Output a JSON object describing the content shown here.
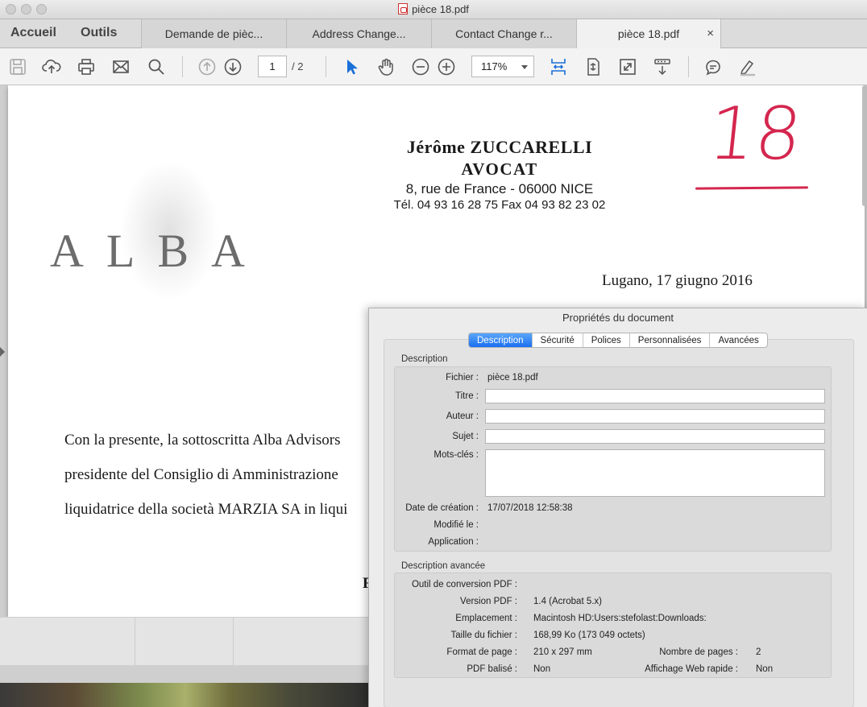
{
  "window": {
    "title": "pièce 18.pdf"
  },
  "nav": {
    "home": "Accueil",
    "tools": "Outils"
  },
  "tabs": [
    {
      "label": "Demande de pièc..."
    },
    {
      "label": "Address Change..."
    },
    {
      "label": "Contact Change r..."
    },
    {
      "label": "pièce 18.pdf",
      "close": "×"
    }
  ],
  "toolbar": {
    "page_current": "1",
    "page_total": "/ 2",
    "zoom": "117%",
    "icons": [
      "save-icon",
      "upload-icon",
      "print-icon",
      "mail-icon",
      "search-icon",
      "prev-page-icon",
      "next-page-icon",
      "select-arrow-icon",
      "hand-icon",
      "zoom-out-icon",
      "zoom-in-icon",
      "scroll-mode-icon",
      "fit-page-icon",
      "full-screen-icon",
      "read-mode-icon",
      "comment-icon",
      "highlight-icon"
    ],
    "accent_color": "#1a6fd8"
  },
  "document": {
    "logo": "ALBA",
    "letterhead": {
      "name": "Jérôme ZUCCARELLI",
      "title": "AVOCAT",
      "address": "8, rue de France - 06000 NICE",
      "phone": "Tél. 04 93 16 28 75  Fax 04 93 82 23 02"
    },
    "piece_number": "18",
    "place_date": "Lugano, 17 giugno 2016",
    "body_lines": [
      "Con la presente, la sottoscritta Alba Advisors",
      "presidente del Consiglio di Amministrazione",
      "liquidatrice della società MARZIA SA in liqui"
    ],
    "body_fragment": "F",
    "stamp_color": "#d4264e"
  },
  "dialog": {
    "title": "Propriétés du document",
    "tabs": [
      "Description",
      "Sécurité",
      "Polices",
      "Personnalisées",
      "Avancées"
    ],
    "active_tab": "Description",
    "description": {
      "group_label": "Description",
      "fields": {
        "file_label": "Fichier :",
        "file_value": "pièce 18.pdf",
        "title_label": "Titre :",
        "title_value": "",
        "author_label": "Auteur :",
        "author_value": "",
        "subject_label": "Sujet :",
        "subject_value": "",
        "keywords_label": "Mots-clés :",
        "keywords_value": "",
        "created_label": "Date de création :",
        "created_value": "17/07/2018 12:58:38",
        "modified_label": "Modifié le :",
        "modified_value": "",
        "application_label": "Application :",
        "application_value": ""
      }
    },
    "advanced": {
      "group_label": "Description avancée",
      "fields": {
        "converter_label": "Outil de conversion PDF :",
        "converter_value": "",
        "version_label": "Version PDF :",
        "version_value": "1.4 (Acrobat 5.x)",
        "location_label": "Emplacement :",
        "location_value": "Macintosh HD:Users:stefolast:Downloads:",
        "size_label": "Taille du fichier :",
        "size_value": "168,99 Ko (173 049 octets)",
        "page_format_label": "Format de page :",
        "page_format_value": "210 x 297 mm",
        "page_count_label": "Nombre de pages :",
        "page_count_value": "2",
        "tagged_label": "PDF balisé :",
        "tagged_value": "Non",
        "fast_web_label": "Affichage Web rapide :",
        "fast_web_value": "Non"
      }
    }
  }
}
